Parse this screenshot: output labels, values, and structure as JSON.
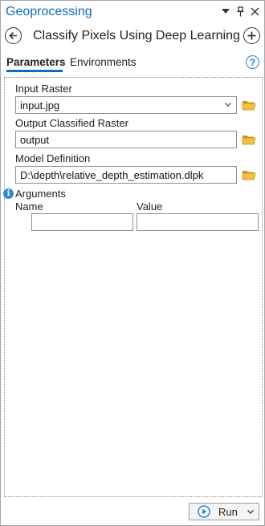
{
  "pane": {
    "title": "Geoprocessing",
    "tool_title": "Classify Pixels Using Deep Learning"
  },
  "tabs": [
    {
      "label": "Parameters",
      "active": true
    },
    {
      "label": "Environments",
      "active": false
    }
  ],
  "params": {
    "input_raster": {
      "label": "Input Raster",
      "value": "input.jpg"
    },
    "output_raster": {
      "label": "Output Classified Raster",
      "value": "output"
    },
    "model_definition": {
      "label": "Model Definition",
      "value": "D:\\depth\\relative_depth_estimation.dlpk"
    },
    "arguments": {
      "label": "Arguments",
      "columns": [
        "Name",
        "Value"
      ],
      "rows": [
        {
          "name": "",
          "value": ""
        }
      ]
    }
  },
  "footer": {
    "run_label": "Run"
  },
  "icons": {
    "back": "back-arrow-icon",
    "add": "add-icon",
    "help": "help-icon",
    "folder": "folder-icon",
    "info": "info-icon",
    "run": "run-icon"
  },
  "colors": {
    "accent": "#0f6cbd",
    "folder": "#e8b530",
    "info": "#2f88d8"
  }
}
